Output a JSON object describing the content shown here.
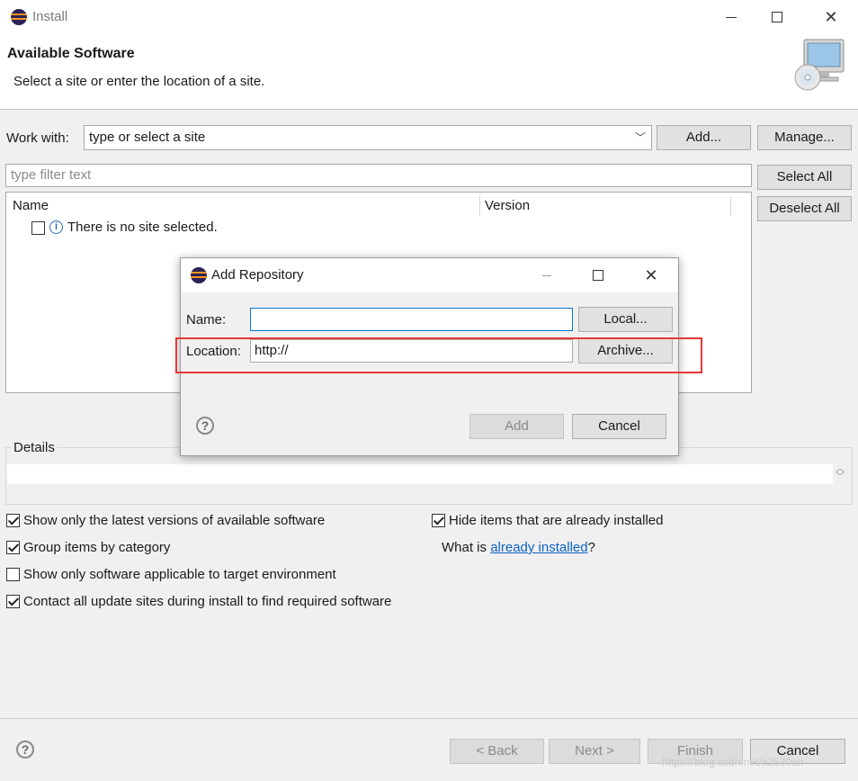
{
  "window": {
    "title": "Install"
  },
  "header": {
    "title": "Available Software",
    "subtitle": "Select a site or enter the location of a site."
  },
  "work_with": {
    "label": "Work with:",
    "value": "type or select a site",
    "add_label": "Add...",
    "manage_label": "Manage..."
  },
  "filter": {
    "placeholder": "type filter text",
    "select_all": "Select All",
    "deselect_all": "Deselect All"
  },
  "table": {
    "columns": [
      "Name",
      "Version"
    ],
    "message": "There is no site selected."
  },
  "details": {
    "label": "Details"
  },
  "options": {
    "show_latest": {
      "label": "Show only the latest versions of available software",
      "checked": true
    },
    "group_by_category": {
      "label": "Group items by category",
      "checked": true
    },
    "show_applicable": {
      "label": "Show only software applicable to target environment",
      "checked": false
    },
    "contact_sites": {
      "label": "Contact all update sites during install to find required software",
      "checked": true
    },
    "hide_installed": {
      "label": "Hide items that are already installed",
      "checked": true
    },
    "what_is_prefix": "What is ",
    "what_is_link": "already installed",
    "what_is_suffix": "?"
  },
  "footer": {
    "back": "< Back",
    "next": "Next >",
    "finish": "Finish",
    "cancel": "Cancel"
  },
  "watermark": "https://blog.csdn.net/a2530ah",
  "dialog": {
    "title": "Add Repository",
    "name_label": "Name:",
    "name_value": "",
    "local_label": "Local...",
    "location_label": "Location:",
    "location_value": "http://",
    "archive_label": "Archive...",
    "add_label": "Add",
    "cancel_label": "Cancel"
  },
  "colors": {
    "highlight_box": "#e83838",
    "link": "#0b62c4",
    "focus_border": "#0078d7"
  }
}
